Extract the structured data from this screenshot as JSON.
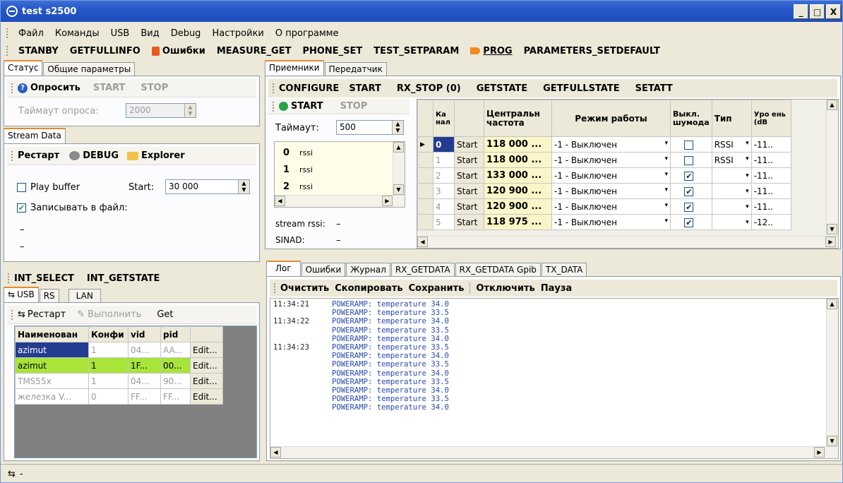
{
  "window": {
    "title": "test s2500",
    "min": "_",
    "max": "□",
    "close": "X"
  },
  "menu": [
    "Файл",
    "Команды",
    "USB",
    "Вид",
    "Debug",
    "Настройки",
    "О программе"
  ],
  "toolbar": {
    "b1": "STANBY",
    "b2": "GETFULLINFO",
    "b3": "Ошибки",
    "b4": "MEASURE_GET",
    "b5": "PHONE_SET",
    "b6": "TEST_SETPARAM",
    "b7": "PROG",
    "b8": "PARAMETERS_SETDEFAULT"
  },
  "left": {
    "tabs": [
      "Статус",
      "Общие параметры"
    ],
    "poll": {
      "query": "Опросить",
      "start": "START",
      "stop": "STOP",
      "timeout_label": "Таймаут опроса:",
      "timeout_value": "2000"
    },
    "stream_tab": "Stream Data",
    "stream": {
      "restart": "Рестарт",
      "debug": "DEBUG",
      "explorer": "Explorer",
      "play_buffer": "Play buffer",
      "start_label": "Start:",
      "start_value": "30 000",
      "write_file": "Записывать в файл:",
      "dash1": "–",
      "dash2": "–"
    },
    "int": {
      "select": "INT_SELECT",
      "getstate": "INT_GETSTATE"
    },
    "conn_tabs": [
      "USB",
      "RS",
      "LAN"
    ],
    "usb": {
      "restart": "Рестарт",
      "execute": "Выполнить",
      "get": "Get",
      "columns": [
        "Наименован",
        "Конфи",
        "vid",
        "pid",
        ""
      ],
      "rows": [
        {
          "name": "azimut",
          "conf": "1",
          "vid": "04...",
          "pid": "AA...",
          "edit": "Edit..."
        },
        {
          "name": "azimut",
          "conf": "1",
          "vid": "1F...",
          "pid": "00...",
          "edit": "Edit..."
        },
        {
          "name": "TMS55x",
          "conf": "1",
          "vid": "04...",
          "pid": "90...",
          "edit": "Edit..."
        },
        {
          "name": "железка V...",
          "conf": "0",
          "vid": "FF...",
          "pid": "FF...",
          "edit": "Edit..."
        }
      ]
    }
  },
  "right": {
    "tabs": [
      "Приемники",
      "Передатчик"
    ],
    "cmds": [
      "CONFIGURE",
      "START",
      "RX_STOP (0)",
      "GETSTATE",
      "GETFULLSTATE",
      "SETATT"
    ],
    "sub": {
      "start": "START",
      "stop": "STOP",
      "timeout_label": "Таймаут:",
      "timeout_value": "500",
      "list": [
        {
          "n": "0",
          "t": "rssi"
        },
        {
          "n": "1",
          "t": "rssi"
        },
        {
          "n": "2",
          "t": "rssi"
        }
      ],
      "stream_rssi": "stream rssi:",
      "stream_rssi_val": "–",
      "sinad": "SINAD:",
      "sinad_val": "–"
    },
    "table": {
      "columns": [
        "Ка нал",
        "",
        "Центральн частота",
        "Режим работы",
        "Выкл. шумода",
        "Тип",
        "Уро ень (dB"
      ],
      "rows": [
        {
          "ch": "0",
          "btn": "Start",
          "freq": "118 000 ...",
          "mode": "-1 - Выключен",
          "chk": "",
          "type": "RSSI",
          "lvl": "-11.."
        },
        {
          "ch": "1",
          "btn": "Start",
          "freq": "118 000 ...",
          "mode": "-1 - Выключен",
          "chk": "",
          "type": "RSSI",
          "lvl": "-11.."
        },
        {
          "ch": "2",
          "btn": "Start",
          "freq": "133 000 ...",
          "mode": "-1 - Выключен",
          "chk": "✔",
          "type": "",
          "lvl": "-11.."
        },
        {
          "ch": "3",
          "btn": "Start",
          "freq": "120 900 ...",
          "mode": "-1 - Выключен",
          "chk": "✔",
          "type": "",
          "lvl": "-11.."
        },
        {
          "ch": "4",
          "btn": "Start",
          "freq": "120 900 ...",
          "mode": "-1 - Выключен",
          "chk": "✔",
          "type": "",
          "lvl": "-11.."
        },
        {
          "ch": "5",
          "btn": "Start",
          "freq": "118 975 ...",
          "mode": "-1 - Выключен",
          "chk": "✔",
          "type": "",
          "lvl": "-12.."
        }
      ]
    }
  },
  "log": {
    "tabs": [
      "Лог",
      "Ошибки",
      "Журнал",
      "RX_GETDATA",
      "RX_GETDATA Gpib",
      "TX_DATA"
    ],
    "actions": {
      "clear": "Очистить",
      "copy": "Скопировать",
      "save": "Сохранить",
      "disable": "Отключить",
      "pause": "Пауза"
    },
    "lines": [
      {
        "t": "11:34:21",
        "m": "POWERAMP: temperature 34.0"
      },
      {
        "t": "",
        "m": "POWERAMP: temperature 33.5"
      },
      {
        "t": "11:34:22",
        "m": "POWERAMP: temperature 34.0"
      },
      {
        "t": "",
        "m": "POWERAMP: temperature 33.5"
      },
      {
        "t": "",
        "m": "POWERAMP: temperature 34.0"
      },
      {
        "t": "11:34:23",
        "m": "POWERAMP: temperature 33.5"
      },
      {
        "t": "",
        "m": "POWERAMP: temperature 34.0"
      },
      {
        "t": "",
        "m": "POWERAMP: temperature 33.5"
      },
      {
        "t": "",
        "m": "POWERAMP: temperature 34.0"
      },
      {
        "t": "",
        "m": "POWERAMP: temperature 33.5"
      },
      {
        "t": "",
        "m": "POWERAMP: temperature 34.0"
      },
      {
        "t": "",
        "m": "POWERAMP: temperature 33.5"
      },
      {
        "t": "",
        "m": "POWERAMP: temperature 34.0"
      }
    ]
  },
  "status": {
    "text": "-"
  },
  "colors": {
    "selected_row": "#a8e43a",
    "title": "#2657c7",
    "log_text": "#2a4bb0"
  }
}
